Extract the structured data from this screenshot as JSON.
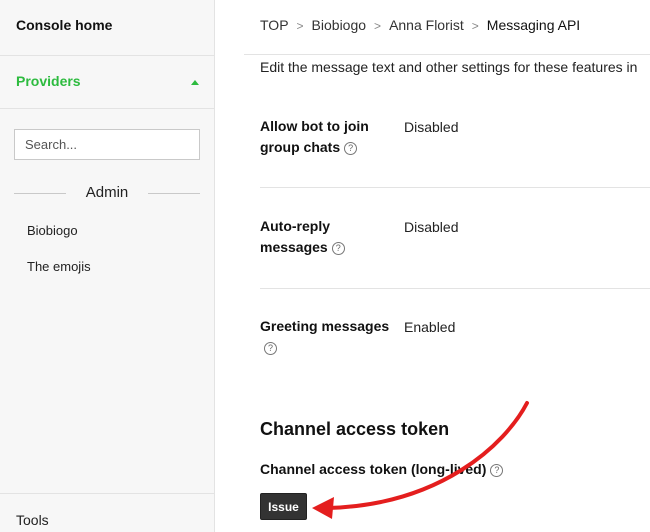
{
  "sidebar": {
    "console_home": "Console home",
    "providers": "Providers",
    "search_placeholder": "Search...",
    "section_heading": "Admin",
    "items": [
      {
        "label": "Biobiogo"
      },
      {
        "label": "The emojis"
      }
    ],
    "tools": "Tools"
  },
  "breadcrumb": {
    "items": [
      "TOP",
      "Biobiogo",
      "Anna Florist",
      "Messaging API"
    ],
    "separator": ">"
  },
  "main": {
    "intro": "Edit the message text and other settings for these features in",
    "settings": [
      {
        "label": "Allow bot to join group chats",
        "value": "Disabled"
      },
      {
        "label": "Auto-reply messages",
        "value": "Disabled"
      },
      {
        "label": "Greeting messages",
        "value": "Enabled"
      }
    ],
    "section_title": "Channel access token",
    "token_label": "Channel access token (long-lived)",
    "issue_button": "Issue"
  },
  "icons": {
    "help": "?",
    "providers_toggle": "caret-up-icon"
  },
  "colors": {
    "accent_green": "#2dbb3f",
    "annotation_red": "#e41e1e",
    "button_dark": "#333333"
  }
}
